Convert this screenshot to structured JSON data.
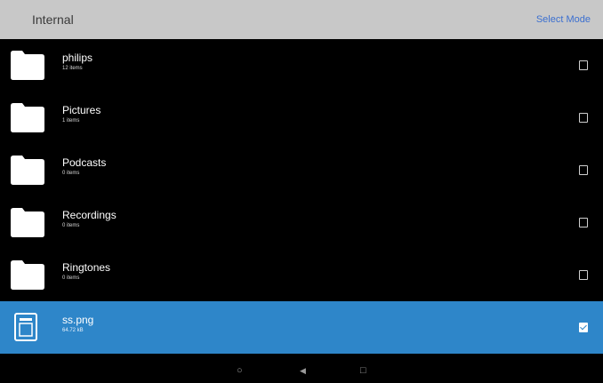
{
  "header": {
    "title": "Internal",
    "select_mode_label": "Select Mode"
  },
  "items": [
    {
      "name": "philips",
      "sub": "12 items",
      "icon": "folder-icon",
      "selected": false
    },
    {
      "name": "Pictures",
      "sub": "1 items",
      "icon": "folder-icon",
      "selected": false
    },
    {
      "name": "Podcasts",
      "sub": "0 items",
      "icon": "folder-icon",
      "selected": false
    },
    {
      "name": "Recordings",
      "sub": "0 items",
      "icon": "folder-icon",
      "selected": false
    },
    {
      "name": "Ringtones",
      "sub": "0 items",
      "icon": "folder-icon",
      "selected": false
    },
    {
      "name": "ss.png",
      "sub": "64.72 kB",
      "icon": "image-file-icon",
      "selected": true
    }
  ],
  "navbar": {
    "back_glyph": "◀",
    "home_glyph": "○",
    "recents_glyph": "□"
  },
  "colors": {
    "header_bg": "#c8c8c8",
    "accent": "#3b6fd0",
    "selected_row": "#2e86c9",
    "background": "#000000"
  }
}
